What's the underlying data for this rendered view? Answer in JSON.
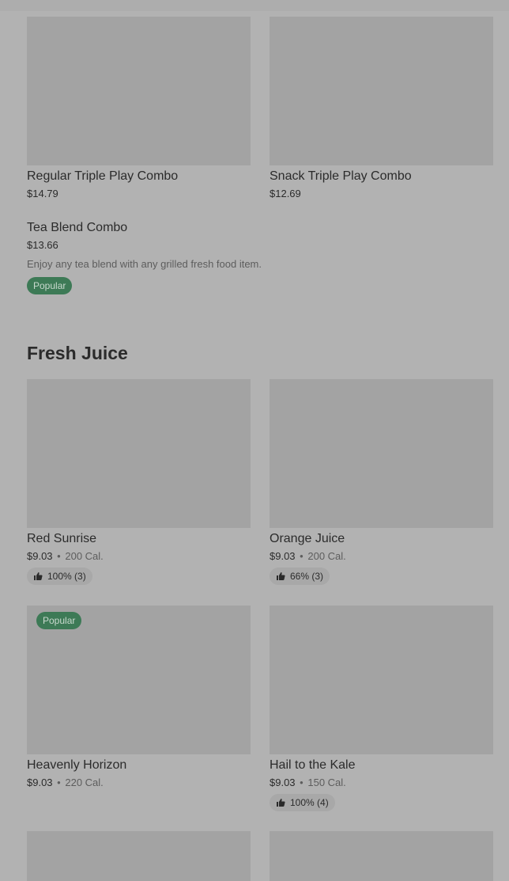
{
  "combos": [
    {
      "name": "Regular Triple Play Combo",
      "price": "$14.79"
    },
    {
      "name": "Snack Triple Play Combo",
      "price": "$12.69"
    }
  ],
  "tea_blend": {
    "name": "Tea Blend Combo",
    "price": "$13.66",
    "description": "Enjoy any tea blend with any grilled fresh food item.",
    "badge": "Popular"
  },
  "fresh_juice": {
    "title": "Fresh Juice",
    "items": [
      {
        "name": "Red Sunrise",
        "price": "$9.03",
        "separator": "•",
        "calories": "200 Cal.",
        "rating": "100% (3)"
      },
      {
        "name": "Orange Juice",
        "price": "$9.03",
        "separator": "•",
        "calories": "200 Cal.",
        "rating": "66% (3)"
      },
      {
        "name": "Heavenly Horizon",
        "price": "$9.03",
        "separator": "•",
        "calories": "220 Cal.",
        "badge": "Popular"
      },
      {
        "name": "Hail to the Kale",
        "price": "$9.03",
        "separator": "•",
        "calories": "150 Cal.",
        "rating": "100% (4)"
      }
    ]
  },
  "icons": {
    "rating": "thumbs-up-icon"
  }
}
